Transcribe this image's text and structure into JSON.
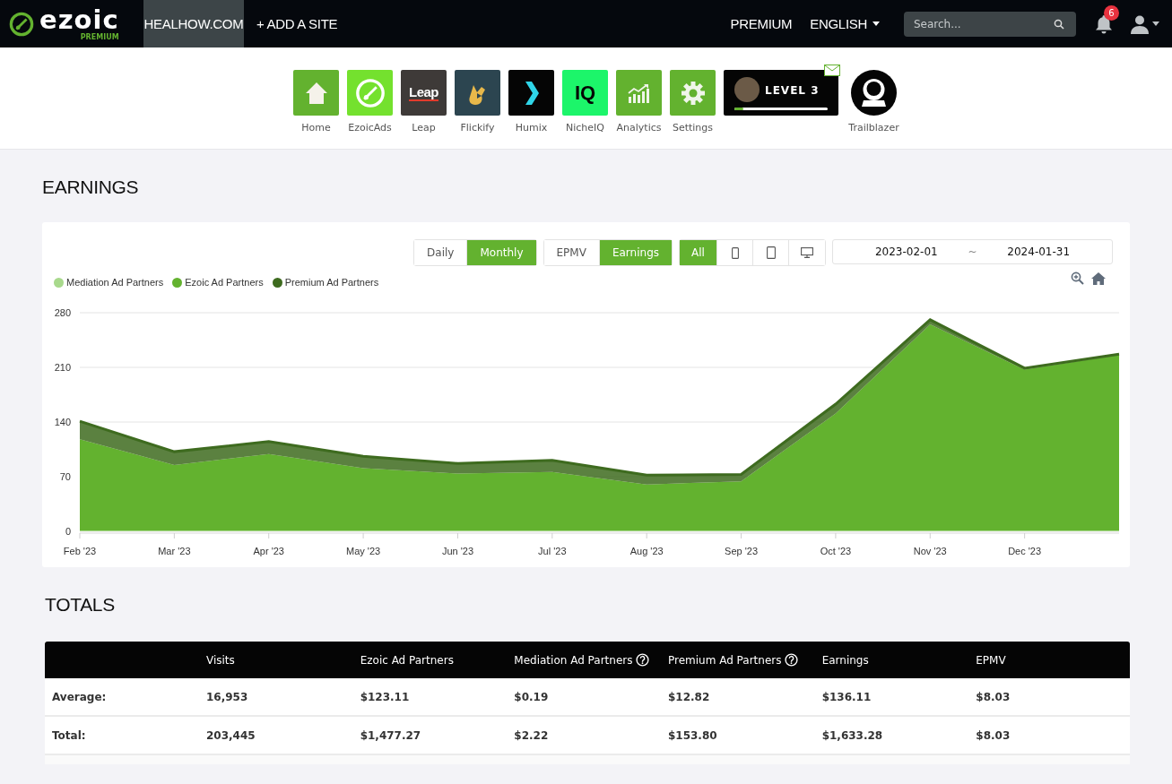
{
  "topbar": {
    "logo": {
      "word": "ezoic",
      "tier": "PREMIUM"
    },
    "sites": [
      {
        "label": "HEALHOW.COM",
        "selected": true
      },
      {
        "label": "+ ADD A SITE",
        "selected": false
      }
    ],
    "links": [
      {
        "label": "PREMIUM",
        "dropdown": false
      },
      {
        "label": "ENGLISH",
        "dropdown": true
      }
    ],
    "search": {
      "placeholder": "Search..."
    },
    "notifications": "6"
  },
  "apps": [
    {
      "label": "Home",
      "kind": "home"
    },
    {
      "label": "EzoicAds",
      "kind": "ezoicads"
    },
    {
      "label": "Leap",
      "kind": "leap",
      "mark": "Leap"
    },
    {
      "label": "Flickify",
      "kind": "flickify"
    },
    {
      "label": "Humix",
      "kind": "humix"
    },
    {
      "label": "NicheIQ",
      "kind": "nicheiq",
      "mark": "IQ"
    },
    {
      "label": "Analytics",
      "kind": "analytics"
    },
    {
      "label": "Settings",
      "kind": "settings"
    }
  ],
  "level_card": {
    "label": "LEVEL 3",
    "level": 0.1
  },
  "badge": {
    "label": "Trailblazer"
  },
  "earnings": {
    "title": "EARNINGS",
    "period_toggle": [
      {
        "label": "Daily",
        "selected": false
      },
      {
        "label": "Monthly",
        "selected": true
      }
    ],
    "metric_toggle": [
      {
        "label": "EPMV",
        "selected": false
      },
      {
        "label": "Earnings",
        "selected": true
      }
    ],
    "device_toggle": [
      {
        "kind": "all",
        "label": "All",
        "selected": true
      },
      {
        "kind": "phone",
        "selected": false
      },
      {
        "kind": "tablet",
        "selected": false
      },
      {
        "kind": "desktop",
        "selected": false
      }
    ],
    "date_range": {
      "start": "2023-02-01",
      "separator": "~",
      "end": "2024-01-31"
    },
    "chart_data": {
      "type": "area",
      "stacked": true,
      "categories": [
        "Feb '23",
        "Mar '23",
        "Apr '23",
        "May '23",
        "Jun '23",
        "Jul '23",
        "Aug '23",
        "Sep '23",
        "Oct '23",
        "Nov '23",
        "Dec '23",
        null
      ],
      "ylim": [
        0,
        280
      ],
      "yticks": [
        0,
        70,
        140,
        210,
        280
      ],
      "series": [
        {
          "name": "Mediation Ad Partners",
          "color": "#a8d98c",
          "values": [
            1,
            1,
            1,
            1,
            1,
            1,
            1,
            1,
            1,
            1,
            1,
            1
          ]
        },
        {
          "name": "Ezoic Ad Partners",
          "color": "#63b22f",
          "values": [
            117,
            84,
            98,
            80,
            73,
            75,
            59,
            63,
            150,
            264,
            206,
            225
          ]
        },
        {
          "name": "Premium Ad Partners",
          "color": "#3e6b1f",
          "values": [
            23,
            17,
            16,
            15,
            13,
            15,
            12,
            9,
            12,
            6,
            2,
            1
          ]
        }
      ]
    }
  },
  "totals": {
    "title": "TOTALS",
    "columns": [
      {
        "label": "Visits",
        "help": false
      },
      {
        "label": "Ezoic Ad Partners",
        "help": false
      },
      {
        "label": "Mediation Ad Partners",
        "help": true
      },
      {
        "label": "Premium Ad Partners",
        "help": true
      },
      {
        "label": "Earnings",
        "help": false
      },
      {
        "label": "EPMV",
        "help": false
      }
    ],
    "rows": [
      {
        "label": "Average:",
        "cells": [
          "16,953",
          "$123.11",
          "$0.19",
          "$12.82",
          "$136.11",
          "$8.03"
        ]
      },
      {
        "label": "Total:",
        "cells": [
          "203,445",
          "$1,477.27",
          "$2.22",
          "$153.80",
          "$1,633.28",
          "$8.03"
        ]
      }
    ]
  }
}
